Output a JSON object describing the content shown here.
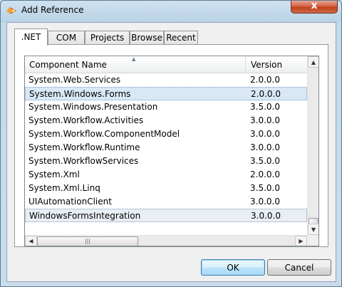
{
  "window": {
    "title": "Add Reference",
    "close_glyph": "x"
  },
  "tabs": [
    {
      "label": ".NET",
      "active": true
    },
    {
      "label": "COM",
      "active": false
    },
    {
      "label": "Projects",
      "active": false
    },
    {
      "label": "Browse",
      "active": false
    },
    {
      "label": "Recent",
      "active": false
    }
  ],
  "list": {
    "columns": [
      "Component Name",
      "Version"
    ],
    "sort_glyph": "▲",
    "rows": [
      {
        "name": "System.Web.Services",
        "version": "2.0.0.0"
      },
      {
        "name": "System.Windows.Forms",
        "version": "2.0.0.0",
        "selected": true
      },
      {
        "name": "System.Windows.Presentation",
        "version": "3.5.0.0"
      },
      {
        "name": "System.Workflow.Activities",
        "version": "3.0.0.0"
      },
      {
        "name": "System.Workflow.ComponentModel",
        "version": "3.0.0.0"
      },
      {
        "name": "System.Workflow.Runtime",
        "version": "3.0.0.0"
      },
      {
        "name": "System.WorkflowServices",
        "version": "3.5.0.0"
      },
      {
        "name": "System.Xml",
        "version": "2.0.0.0"
      },
      {
        "name": "System.Xml.Linq",
        "version": "3.5.0.0"
      },
      {
        "name": "UIAutomationClient",
        "version": "3.0.0.0"
      },
      {
        "name": "WindowsFormsIntegration",
        "version": "3.0.0.0",
        "selected": true
      }
    ]
  },
  "buttons": {
    "ok": "OK",
    "cancel": "Cancel"
  },
  "colors": {
    "selection": "#d9e8f7",
    "default_button": "#3c7fb1"
  }
}
